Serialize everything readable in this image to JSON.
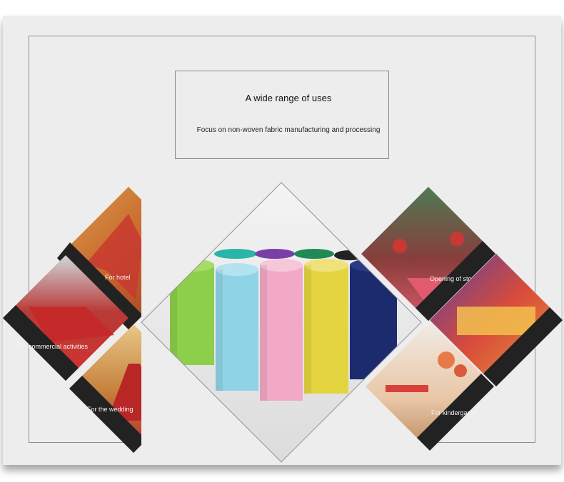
{
  "heading": {
    "title": "A wide range of uses",
    "subtitle": "Focus on non-woven fabric manufacturing and processing"
  },
  "uses": [
    {
      "label": "For hotel",
      "icon": "hotel-carpet-photo"
    },
    {
      "label": "For commercial activities",
      "icon": "commercial-carpet-photo"
    },
    {
      "label": "For the wedding",
      "icon": "wedding-carpet-photo"
    },
    {
      "label": "Opening of stores",
      "icon": "store-opening-photo"
    },
    {
      "label": "For kindergarten",
      "icon": "kindergarten-photo"
    }
  ],
  "colors": {
    "background": "#ededed",
    "frame": "#8a8a8a",
    "roll_green": "#8ccf4a",
    "roll_cyan": "#8fd3e6",
    "roll_pink": "#f1a9c6",
    "roll_yellow": "#e4d540",
    "roll_navy": "#1c2a6e",
    "carpet_red": "#c8282d"
  }
}
